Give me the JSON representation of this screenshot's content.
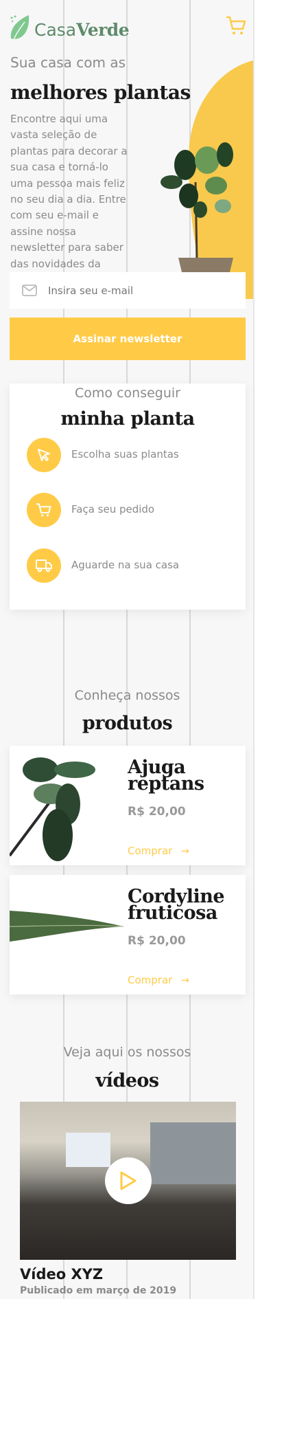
{
  "header": {
    "logo_text_regular": "Casa",
    "logo_text_bold": "Verde",
    "cart_icon": "cart-icon"
  },
  "hero": {
    "subtitle": "Sua casa com as",
    "title": "melhores plantas",
    "description": "Encontre aqui uma vasta seleção de plantas para decorar a sua casa e torná-lo uma pessoa mais feliz no seu dia a dia. Entre com seu e-mail e assine nossa newsletter para saber das novidades da marca",
    "email_placeholder": "Insira seu e-mail",
    "subscribe_label": "Assinar newsletter"
  },
  "how": {
    "subtitle": "Como conseguir",
    "title": "minha planta",
    "steps": [
      {
        "icon": "cursor-icon",
        "label": "Escolha suas plantas"
      },
      {
        "icon": "cart-icon",
        "label": "Faça seu pedido"
      },
      {
        "icon": "truck-icon",
        "label": "Aguarde na sua casa"
      }
    ]
  },
  "products": {
    "subtitle": "Conheça nossos",
    "title": "produtos",
    "items": [
      {
        "name": "Ajuga reptans",
        "price": "R$ 20,00",
        "buy_label": "Comprar"
      },
      {
        "name": "Cordyline fruticosa",
        "price": "R$ 20,00",
        "buy_label": "Comprar"
      }
    ]
  },
  "videos": {
    "subtitle": "Veja aqui os nossos",
    "title": "vídeos",
    "video_title": "Vídeo XYZ",
    "published": "Publicado em março de 2019"
  },
  "colors": {
    "accent": "#ffcb47",
    "brand_green": "#5e8a6a",
    "leaf_green": "#7fc98f"
  }
}
